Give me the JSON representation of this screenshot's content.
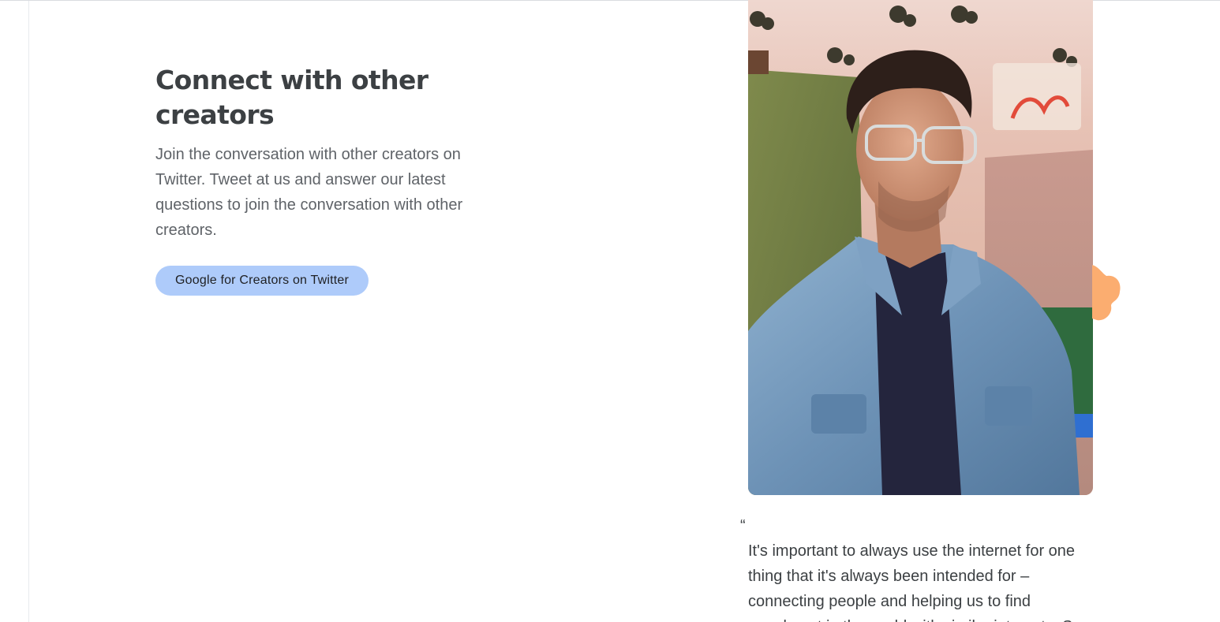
{
  "section": {
    "heading_line1": "Connect with other",
    "heading_line2": "creators",
    "body": "Join the conversation with other creators on Twitter. Tweet at us and answer our latest questions to join the conversation with other creators.",
    "cta_label": "Google for Creators on Twitter"
  },
  "testimonial": {
    "quote_mark": "“",
    "quote_lines": [
      "It's important to always use the internet for one",
      "thing that it's always been intended for –",
      "connecting people and helping us to find",
      "people out in the world with similar interests. So"
    ],
    "photo_icon": "creator-portrait-image"
  },
  "colors": {
    "cta_background": "#aecbfa",
    "blob_accent": "#fbad70",
    "heading": "#3c4043",
    "body": "#5f6368"
  }
}
